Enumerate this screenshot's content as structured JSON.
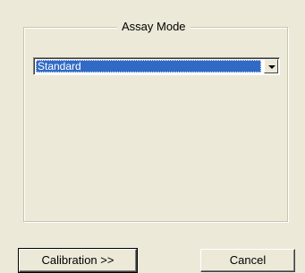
{
  "assay_mode": {
    "title": "Assay Mode",
    "selected_value": "Standard"
  },
  "buttons": {
    "calibration_label": "Calibration  >>",
    "cancel_label": "Cancel"
  },
  "icons": {
    "dropdown": "chevron-down-icon"
  }
}
